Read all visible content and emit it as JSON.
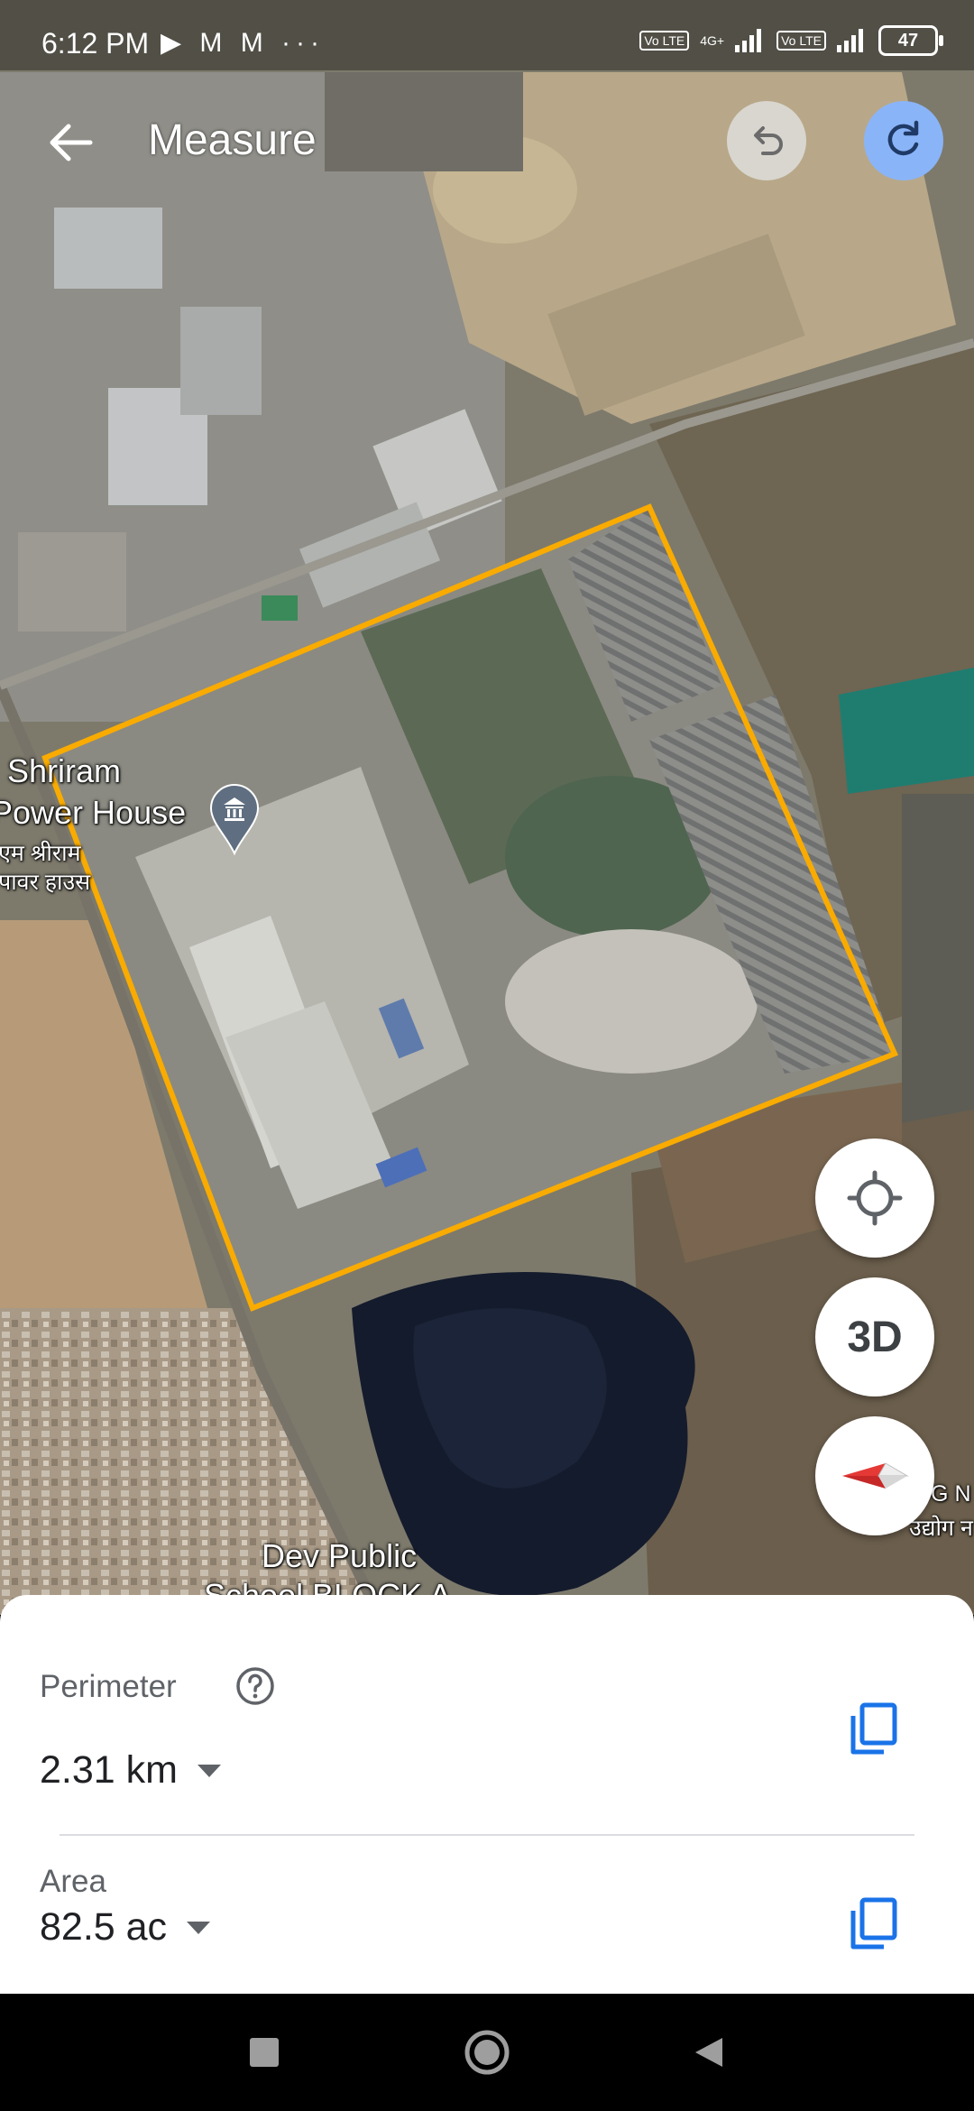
{
  "status_bar": {
    "time": "6:12 PM",
    "left_icons": [
      "play-shield-icon",
      "gmail-icon",
      "gmail-icon",
      "more-dots-icon"
    ],
    "left_icons_text": "▶ M M ···",
    "sim1": "Vo LTE",
    "net_type": "4G+",
    "sim2": "Vo LTE",
    "battery": "47"
  },
  "header": {
    "title": "Measure",
    "back_icon": "arrow-back-icon",
    "undo_icon": "undo-icon",
    "redo_icon": "redo-icon",
    "accent": "#8ab4f8"
  },
  "map": {
    "labels": {
      "place_name_1": "Shriram",
      "place_name_2": "Power House",
      "place_hindi_1": "एम श्रीराम",
      "place_hindi_2": "पावर हाउस",
      "school_1": "Dev Public",
      "school_2": "School BLOCK A",
      "edge_1": "DG N",
      "edge_2": "उद्योग न"
    },
    "polygon_color": "#f9ab00"
  },
  "fabs": {
    "locate_icon": "my-location-icon",
    "threed_label": "3D",
    "compass_icon": "compass-icon"
  },
  "sheet": {
    "perimeter_label": "Perimeter",
    "perimeter_value": "2.31 km",
    "area_label": "Area",
    "area_value": "82.5 ac",
    "copy_color": "#1a73e8"
  },
  "nav": {
    "recents_icon": "square-icon",
    "home_icon": "circle-icon",
    "back_icon": "triangle-back-icon"
  }
}
